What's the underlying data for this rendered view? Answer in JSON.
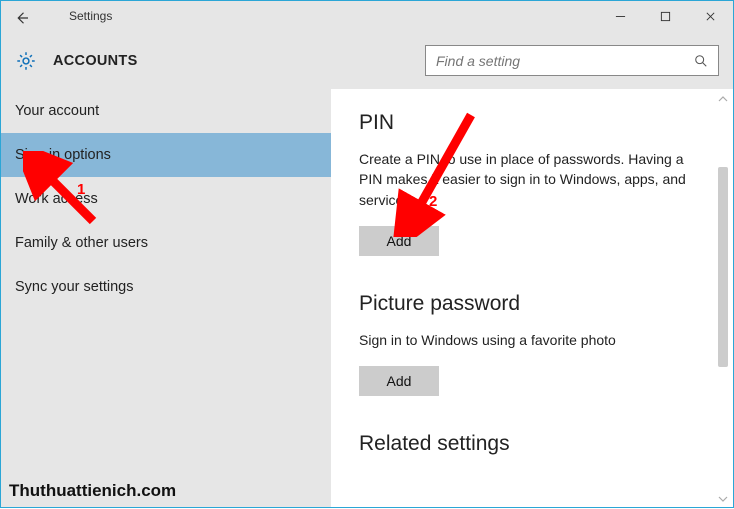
{
  "window": {
    "title": "Settings"
  },
  "header": {
    "category": "ACCOUNTS",
    "search_placeholder": "Find a setting"
  },
  "sidebar": {
    "items": [
      {
        "label": "Your account"
      },
      {
        "label": "Sign-in options"
      },
      {
        "label": "Work access"
      },
      {
        "label": "Family & other users"
      },
      {
        "label": "Sync your settings"
      }
    ],
    "selected_index": 1
  },
  "content": {
    "sections": [
      {
        "heading": "PIN",
        "desc": "Create a PIN to use in place of passwords. Having a PIN makes it easier to sign in to Windows, apps, and services.",
        "button": "Add"
      },
      {
        "heading": "Picture password",
        "desc": "Sign in to Windows using a favorite photo",
        "button": "Add"
      },
      {
        "heading": "Related settings"
      }
    ]
  },
  "annotations": {
    "arrow1_label": "1",
    "arrow2_label": "2"
  },
  "watermark": "Thuthuattienich.com"
}
